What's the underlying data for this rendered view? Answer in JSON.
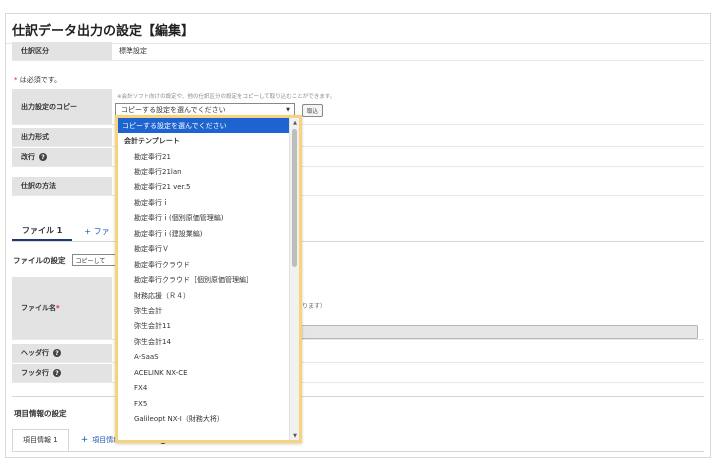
{
  "page": {
    "title": "仕訳データ出力の設定【編集】",
    "journal_type_label": "仕訳区分",
    "journal_type_value": "標準設定",
    "required_note": "は必須です。",
    "required_mark": "*",
    "copy_label": "出力設定のコピー",
    "copy_note": "※会計ソフト向けの設定や、他の仕訳区分の設定をコピーして取り込むことができます。",
    "copy_select_value": "コピーする設定を選んでください",
    "copy_load_button": "取込",
    "output_format_label": "出力形式",
    "line_break_label": "改行",
    "journal_method_label": "仕訳の方法",
    "file_tab": "ファイル 1",
    "add_file_tab": "+ ファ",
    "file_settings_label": "ファイルの設定",
    "file_settings_select": "コピーして",
    "file_name_label": "ファイル名",
    "file_name_hint": "になります）",
    "header_row_label": "ヘッダ行",
    "footer_row_label": "フッタ行",
    "item_info_label": "項目情報の設定",
    "item_tab": "項目情報 1",
    "add_item_label": "項目情報を追加する"
  },
  "dropdown": {
    "options": [
      {
        "label": "コピーする設定を選んでください",
        "kind": "selected"
      },
      {
        "label": "会計テンプレート",
        "kind": "group"
      },
      {
        "label": "勘定奉行21",
        "kind": "option"
      },
      {
        "label": "勘定奉行21lan",
        "kind": "option"
      },
      {
        "label": "勘定奉行21 ver.5",
        "kind": "option"
      },
      {
        "label": "勘定奉行ｉ",
        "kind": "option"
      },
      {
        "label": "勘定奉行ｉ(個別原価管理編)",
        "kind": "option"
      },
      {
        "label": "勘定奉行ｉ(建設業編)",
        "kind": "option"
      },
      {
        "label": "勘定奉行Ｖ",
        "kind": "option"
      },
      {
        "label": "勘定奉行クラウド",
        "kind": "option"
      },
      {
        "label": "勘定奉行クラウド［個別原価管理編］",
        "kind": "option"
      },
      {
        "label": "財務応援（Ｒ４）",
        "kind": "option"
      },
      {
        "label": "弥生会計",
        "kind": "option"
      },
      {
        "label": "弥生会計11",
        "kind": "option"
      },
      {
        "label": "弥生会計14",
        "kind": "option"
      },
      {
        "label": "A-SaaS",
        "kind": "option"
      },
      {
        "label": "ACELINK NX-CE",
        "kind": "option"
      },
      {
        "label": "FX4",
        "kind": "option"
      },
      {
        "label": "FX5",
        "kind": "option"
      },
      {
        "label": "Galileopt NX-I（財務大将）",
        "kind": "option"
      }
    ]
  },
  "icons": {
    "help": "?",
    "select_arrow": "▼",
    "scroll_up": "▲",
    "scroll_down": "▼"
  },
  "colors": {
    "selected_option_bg": "#1e64d0",
    "dropdown_highlight": "#f6d47c",
    "label_bg": "#e3e3e3",
    "link_blue": "#1a57b5",
    "required_red": "#d9202c"
  }
}
